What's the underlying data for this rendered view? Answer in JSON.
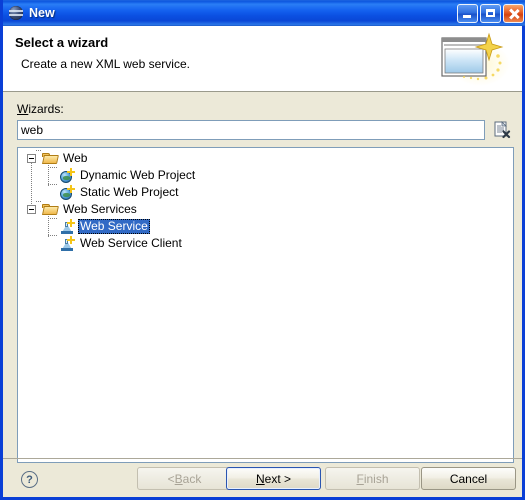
{
  "window": {
    "title": "New",
    "icon": "eclipse-globe-icon",
    "controls": {
      "minimize": "minimize-button",
      "maximize": "maximize-button",
      "close": "close-button"
    }
  },
  "header": {
    "title": "Select a wizard",
    "description": "Create a new XML web service.",
    "banner_icon": "new-wizard-banner-icon"
  },
  "filter": {
    "label_prefix": "W",
    "label_rest": "izards:",
    "value": "web",
    "placeholder": "",
    "clear_icon": "clear-filter-icon"
  },
  "tree": {
    "items": [
      {
        "label": "Web",
        "icon": "folder-icon",
        "depth": 0,
        "expanded": true,
        "selected": false
      },
      {
        "label": "Dynamic Web Project",
        "icon": "web-project-icon",
        "depth": 1,
        "expanded": null,
        "selected": false
      },
      {
        "label": "Static Web Project",
        "icon": "web-project-icon",
        "depth": 1,
        "expanded": null,
        "selected": false
      },
      {
        "label": "Web Services",
        "icon": "folder-icon",
        "depth": 0,
        "expanded": true,
        "selected": false
      },
      {
        "label": "Web Service",
        "icon": "web-service-icon",
        "depth": 1,
        "expanded": null,
        "selected": true
      },
      {
        "label": "Web Service Client",
        "icon": "web-service-icon",
        "depth": 1,
        "expanded": null,
        "selected": false
      }
    ]
  },
  "buttons": {
    "help": "?",
    "back": {
      "pre": "< ",
      "mn": "B",
      "post": "ack",
      "enabled": false
    },
    "next": {
      "pre": "",
      "mn": "N",
      "post": "ext >",
      "enabled": true,
      "default": true
    },
    "finish": {
      "pre": "",
      "mn": "F",
      "post": "inish",
      "enabled": false
    },
    "cancel": {
      "pre": "",
      "mn": "",
      "post": "Cancel",
      "enabled": true
    }
  },
  "colors": {
    "title_bar": "#0d57e0",
    "dialog_bg": "#ece9d8",
    "selection": "#316ac5",
    "field_border": "#7f9db9",
    "close_button": "#d3410f"
  }
}
